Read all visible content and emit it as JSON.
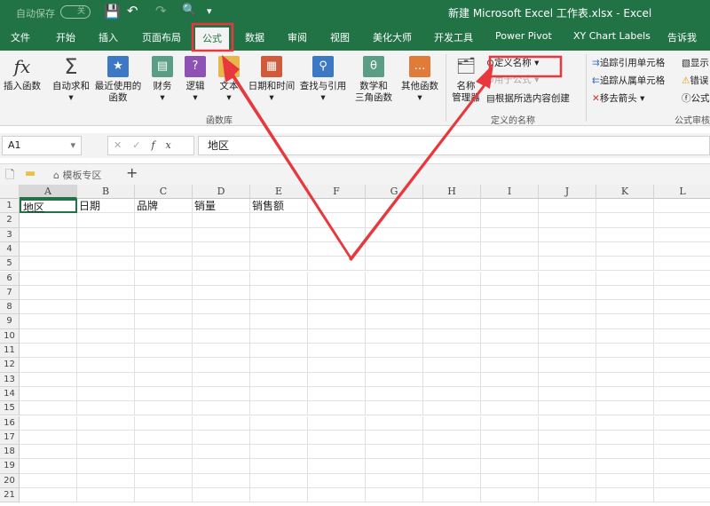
{
  "titlebar": {
    "autosave": "自动保存",
    "toggle": "关",
    "title": "新建 Microsoft Excel 工作表.xlsx  -  Excel"
  },
  "tabs": [
    "文件",
    "开始",
    "插入",
    "页面布局",
    "公式",
    "数据",
    "审阅",
    "视图",
    "美化大师",
    "开发工具",
    "Power Pivot",
    "XY Chart Labels",
    "告诉我"
  ],
  "active_tab": "公式",
  "ribbon": {
    "buttons": [
      {
        "label": "插入函数",
        "icon": "fx-icon"
      },
      {
        "label": "自动求和",
        "icon": "sigma-icon"
      },
      {
        "label": "最近使用的\n函数",
        "icon": "star-book-icon"
      },
      {
        "label": "财务",
        "icon": "finance-book-icon"
      },
      {
        "label": "逻辑",
        "icon": "question-book-icon"
      },
      {
        "label": "文本",
        "icon": "text-book-icon"
      },
      {
        "label": "日期和时间",
        "icon": "calendar-book-icon"
      },
      {
        "label": "查找与引用",
        "icon": "search-book-icon"
      },
      {
        "label": "数学和\n三角函数",
        "icon": "theta-book-icon"
      },
      {
        "label": "其他函数",
        "icon": "more-book-icon"
      },
      {
        "label": "名称\n管理器",
        "icon": "name-manager-icon"
      }
    ],
    "group1": "函数库",
    "define_name": "定义名称",
    "use_in_formula": "用于公式",
    "create_from_selection": "根据所选内容创建",
    "group2": "定义的名称",
    "trace_precedents": "追踪引用单元格",
    "trace_dependents": "追踪从属单元格",
    "remove_arrows": "移去箭头",
    "show": "显示",
    "error": "错误",
    "formula": "公式",
    "group3": "公式审核"
  },
  "formula_bar": {
    "name_box": "A1",
    "content": "地区"
  },
  "sheet_tabs": {
    "template": "模板专区",
    "add": "+"
  },
  "columns": [
    "A",
    "B",
    "C",
    "D",
    "E",
    "F",
    "G",
    "H",
    "I",
    "J",
    "K",
    "L"
  ],
  "rows": 21,
  "cells": {
    "A1": "地区",
    "B1": "日期",
    "C1": "品牌",
    "D1": "销量",
    "E1": "销售额"
  },
  "annotation_color": "#e8383d"
}
